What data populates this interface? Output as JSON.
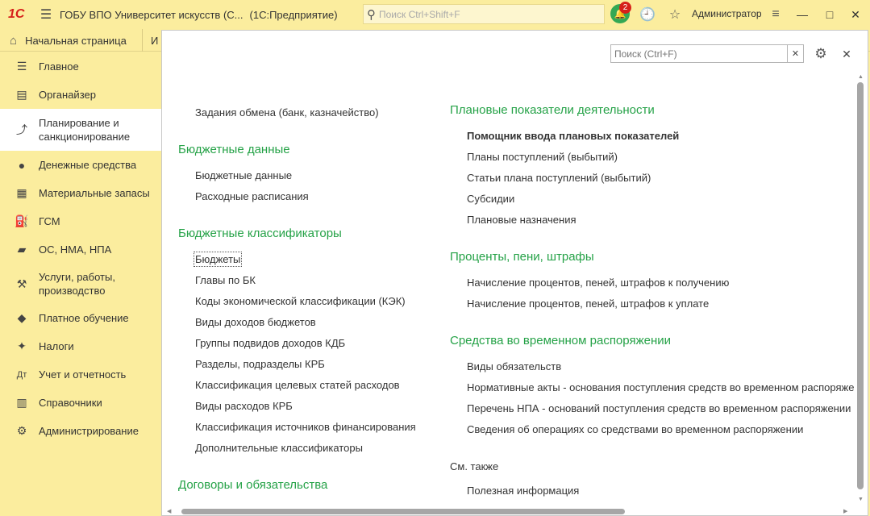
{
  "titlebar": {
    "logo": "1С",
    "title": "ГОБУ ВПО Университет искусств (С...",
    "mode": "(1С:Предприятие)",
    "search_placeholder": "Поиск Ctrl+Shift+F",
    "notif_count": "2",
    "user": "Администратор"
  },
  "tabs": {
    "home": "Начальная страница",
    "other": "И"
  },
  "sidebar": {
    "items": [
      {
        "label": "Главное",
        "icon": "list-icon",
        "glyph": "☰"
      },
      {
        "label": "Органайзер",
        "icon": "clipboard-icon",
        "glyph": "▤"
      },
      {
        "label": "Планирование и санкционирование",
        "icon": "plan-chart-icon",
        "glyph": "⤴"
      },
      {
        "label": "Денежные средства",
        "icon": "coin-icon",
        "glyph": "●"
      },
      {
        "label": "Материальные запасы",
        "icon": "grid-icon",
        "glyph": "▦"
      },
      {
        "label": "ГСМ",
        "icon": "fuel-icon",
        "glyph": "⛽"
      },
      {
        "label": "ОС, НМА, НПА",
        "icon": "truck-icon",
        "glyph": "▰"
      },
      {
        "label": "Услуги, работы, производство",
        "icon": "tools-icon",
        "glyph": "⚒"
      },
      {
        "label": "Платное обучение",
        "icon": "graduation-cap-icon",
        "glyph": "◆"
      },
      {
        "label": "Налоги",
        "icon": "emblem-icon",
        "glyph": "✦"
      },
      {
        "label": "Учет и отчетность",
        "icon": "accounting-icon",
        "glyph": "Дт"
      },
      {
        "label": "Справочники",
        "icon": "books-icon",
        "glyph": "▥"
      },
      {
        "label": "Администрирование",
        "icon": "gear-icon",
        "glyph": "⚙"
      }
    ]
  },
  "panel": {
    "search_placeholder": "Поиск (Ctrl+F)",
    "left": {
      "top_link": "Задания обмена (банк, казначейство)",
      "budget_data": {
        "title": "Бюджетные данные",
        "links": [
          "Бюджетные данные",
          "Расходные расписания"
        ]
      },
      "budget_class": {
        "title": "Бюджетные классификаторы",
        "links": [
          "Бюджеты",
          "Главы по БК",
          "Коды экономической классификации (КЭК)",
          "Виды доходов бюджетов",
          "Группы подвидов доходов КДБ",
          "Разделы, подразделы КРБ",
          "Классификация целевых статей расходов",
          "Виды расходов КРБ",
          "Классификация источников финансирования",
          "Дополнительные классификаторы"
        ]
      },
      "contracts": {
        "title": "Договоры и обязательства"
      }
    },
    "right": {
      "plan": {
        "title": "Плановые показатели деятельности",
        "links": [
          "Помощник ввода плановых показателей",
          "Планы поступлений (выбытий)",
          "Статьи плана поступлений (выбытий)",
          "Субсидии",
          "Плановые назначения"
        ]
      },
      "penalties": {
        "title": "Проценты, пени, штрафы",
        "links": [
          "Начисление процентов, пеней, штрафов к получению",
          "Начисление процентов, пеней, штрафов к уплате"
        ]
      },
      "temp": {
        "title": "Средства во временном распоряжении",
        "links": [
          "Виды обязательств",
          "Нормативные акты - основания  поступления средств во временном распоряже",
          "Перечень НПА - оснований поступления средств во временном распоряжении",
          "Сведения об операциях со средствами во временном распоряжении"
        ]
      },
      "see_also": {
        "title": "См. также",
        "links": [
          "Полезная информация"
        ]
      }
    }
  }
}
